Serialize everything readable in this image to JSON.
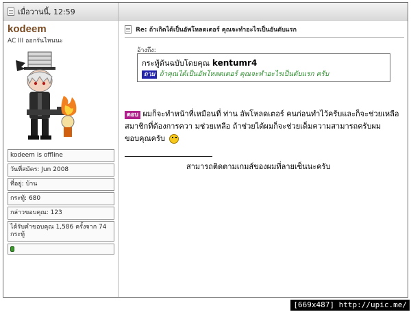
{
  "header": {
    "timestamp": "เมื่อวานนี้, 12:59"
  },
  "user": {
    "name": "kodeem",
    "title": "AC III ออกรันไหนนะ",
    "status": "kodeem is offline",
    "join_date": "วันที่สมัคร: Jun 2008",
    "location": "ที่อยู่: บ้าน",
    "posts": "กระทู้: 680",
    "thanks_given": "กล่าวขอบคุณ: 123",
    "thanks_received": "ได้รับคำขอบคุณ 1,586 ครั้งจาก 74 กระทู้",
    "online_color": "#3c9a2c"
  },
  "post": {
    "title": "Re: ถ้าเกิดได้เป็นอัพโหลดเตอร์ คุณจะทำอะไรเป็นอันดับแรก",
    "quote_label": "อ้างถึง:",
    "quote_by_prefix": "กระทู้ต้นฉบับโดยคุณ",
    "quote_author": "kentumr4",
    "ask_tag": "ถาม",
    "quote_text": "ถ้าคุณได้เป็นอัพโหลดเตอร์ คุณจะทำอะไรเป็นดับแรก ครับ",
    "answer_tag": "ตอบ",
    "answer_text": "ผมก็จะทำหน้าที่เหมือนที่ ท่าน อัพโหลดเตอร์ คนก่อนทำไว้ครับและก็จะช่วยเหลือสมาชิกที่ต้องการควา มช่วยเหลือ ถ้าช่วยได้ผมก็จะช่วยเต็มความสามารถครับผม ขอบคุณครับ",
    "signature": "สามารถติดตามเกมส์ของผมที่ลายเซ็นนะครับ"
  },
  "watermark": "[669x487] http://upic.me/"
}
